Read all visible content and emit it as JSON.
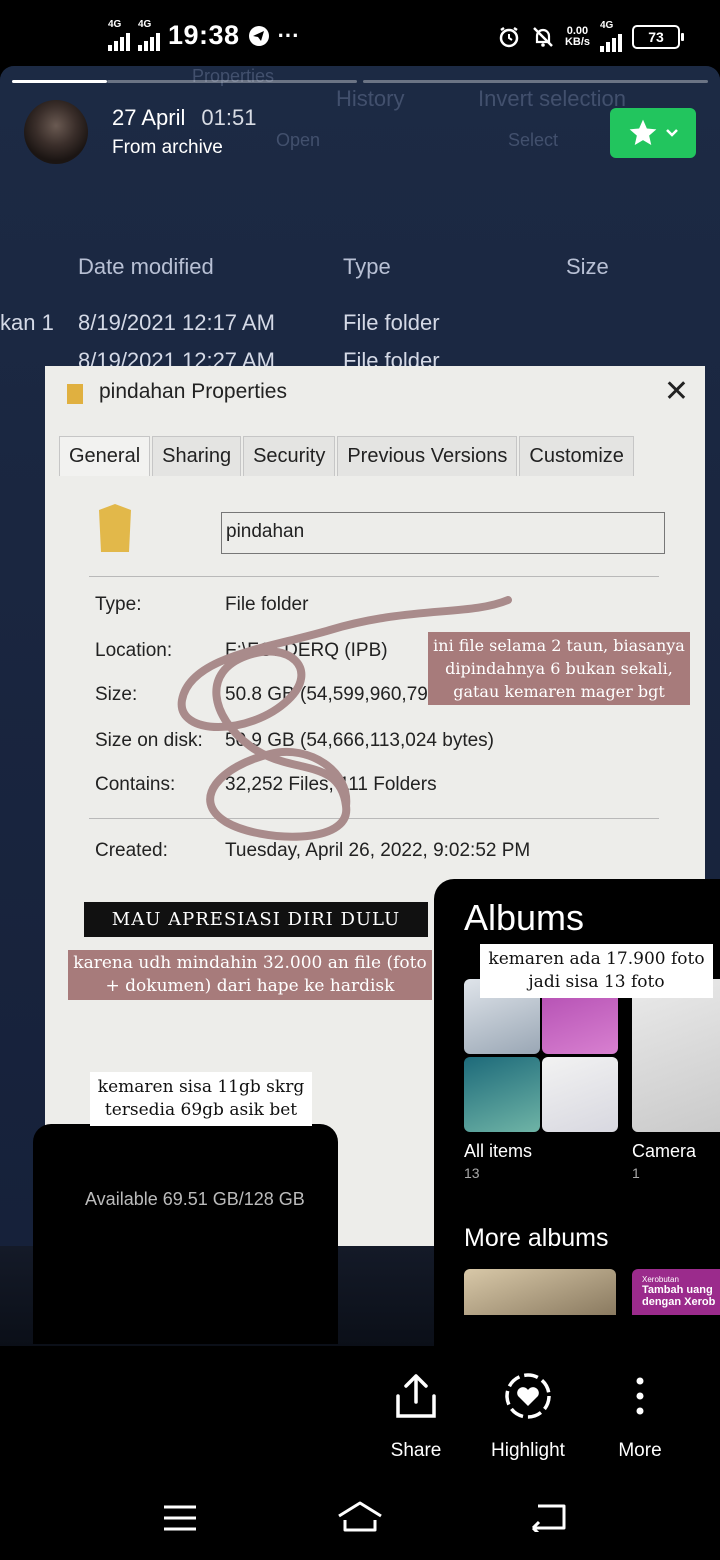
{
  "status_bar": {
    "network1": "4G",
    "network2": "4G",
    "time": "19:38",
    "speed_value": "0.00",
    "speed_unit": "KB/s",
    "network3": "4G",
    "battery": "73"
  },
  "story": {
    "progress": [
      1,
      0,
      0
    ],
    "date": "27 April",
    "time": "01:51",
    "source": "From archive"
  },
  "photo": {
    "toolbar": {
      "properties": "Properties",
      "history": "History",
      "invert_selection": "Invert selection",
      "open": "Open",
      "select": "Select"
    },
    "columns": {
      "date_modified": "Date modified",
      "type": "Type",
      "size": "Size"
    },
    "row1": {
      "name": "kan 1",
      "date": "8/19/2021 12:17 AM",
      "type": "File folder"
    },
    "row2": {
      "date": "8/19/2021 12:27 AM",
      "type": "File folder"
    },
    "dialog": {
      "title": "pindahan Properties",
      "tabs": [
        "General",
        "Sharing",
        "Security",
        "Previous Versions",
        "Customize"
      ],
      "folder_name": "pindahan",
      "type_label": "Type:",
      "type_value": "File folder",
      "location_label": "Location:",
      "location_value": "F:\\FOLDERQ (IPB)",
      "size_label": "Size:",
      "size_value": "50.8 GB (54,599,960,790 bytes)",
      "size_on_disk_label": "Size on disk:",
      "size_on_disk_value": "50.9 GB (54,666,113,024 bytes)",
      "contains_label": "Contains:",
      "contains_value": "32,252 Files, 111 Folders",
      "created_label": "Created:",
      "created_value": "Tuesday, April 26, 2022, 9:02:52 PM"
    }
  },
  "notes": {
    "note1": "ini file selama 2 taun, biasanya dipindahnya 6 bukan sekali, gatau kemaren mager bgt",
    "note2": "MAU APRESIASI DIRI DULU",
    "note3": "karena udh mindahin 32.000 an file (foto + dokumen) dari hape ke hardisk",
    "note4": "kemaren ada 17.900 foto jadi sisa 13 foto",
    "note5": "kemaren sisa 11gb skrg tersedia 69gb asik bet"
  },
  "albums": {
    "title": "Albums",
    "items": [
      {
        "name": "All items",
        "count": "13"
      },
      {
        "name": "Camera",
        "count": "1"
      }
    ],
    "more_title": "More albums",
    "thumb_text": [
      "Xerobutan",
      "Tambah uang",
      "dengan Xerob"
    ]
  },
  "storage": {
    "available": "Available 69.51 GB/128 GB"
  },
  "actions": {
    "share": "Share",
    "highlight": "Highlight",
    "more": "More"
  },
  "colors": {
    "accent_green": "#22c55e",
    "note_mauve": "#a77b7b"
  }
}
